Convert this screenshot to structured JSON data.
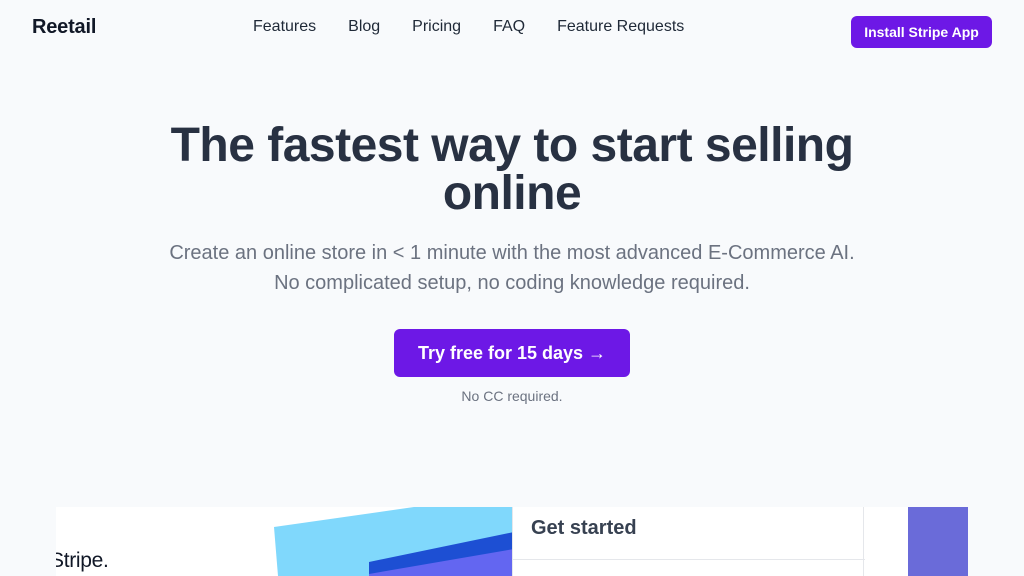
{
  "nav": {
    "logo": "Reetail",
    "links": [
      "Features",
      "Blog",
      "Pricing",
      "FAQ",
      "Feature Requests"
    ],
    "install_button": "Install Stripe App"
  },
  "hero": {
    "title": "The fastest way to start selling online",
    "subtitle_line1": "Create an online store in < 1 minute with the most advanced E-Commerce AI.",
    "subtitle_line2": "No complicated setup, no coding knowledge required.",
    "cta_label": "Try free for 15 days →",
    "cta_note": "No CC required."
  },
  "preview": {
    "stripe_text": "Stripe.",
    "card_title": "Get started"
  },
  "colors": {
    "accent": "#6d18e6",
    "title": "#283142",
    "muted": "#6b7280",
    "background": "#f8fafc"
  }
}
